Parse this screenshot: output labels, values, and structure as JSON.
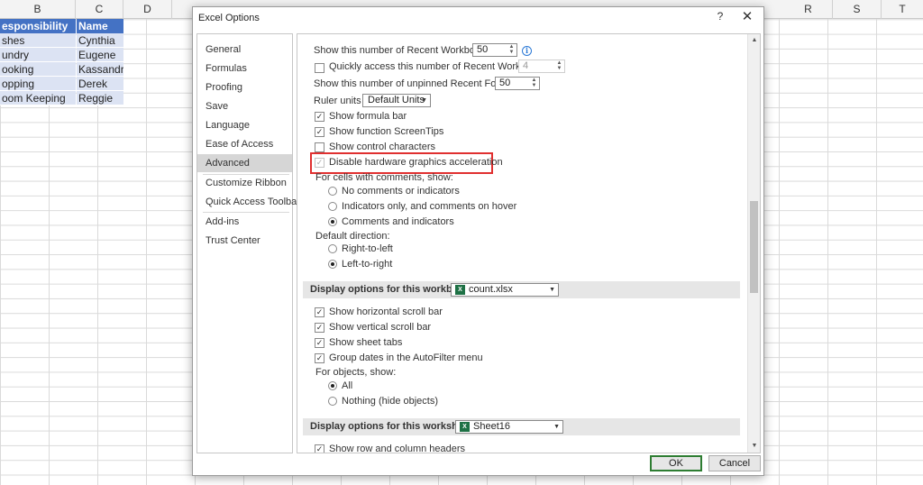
{
  "sheet": {
    "columns": [
      "B",
      "C",
      "D",
      "R",
      "S",
      "T"
    ],
    "header_row": [
      "esponsibility",
      "Name"
    ],
    "rows": [
      [
        "shes",
        "Cynthia"
      ],
      [
        "undry",
        "Eugene"
      ],
      [
        "ooking",
        "Kassandra"
      ],
      [
        "opping",
        "Derek"
      ],
      [
        "oom Keeping",
        "Reggie"
      ]
    ]
  },
  "dialog": {
    "title": "Excel Options",
    "help": "?",
    "close": "✕",
    "nav": [
      "General",
      "Formulas",
      "Proofing",
      "Save",
      "Language",
      "Ease of Access",
      "Advanced",
      "Customize Ribbon",
      "Quick Access Toolbar",
      "Add-ins",
      "Trust Center"
    ],
    "selected_nav": "Advanced",
    "content": {
      "recent_workbooks_label": "Show this number of Recent Workbooks:",
      "recent_workbooks_value": "50",
      "quick_access_label": "Quickly access this number of Recent Workbooks:",
      "quick_access_value": "4",
      "unpinned_folders_label": "Show this number of unpinned Recent Folders:",
      "unpinned_folders_value": "50",
      "ruler_units_label": "Ruler units",
      "ruler_units_value": "Default Units",
      "show_formula_bar": "Show formula bar",
      "show_function_screentips": "Show function ScreenTips",
      "show_control_characters": "Show control characters",
      "disable_hw_accel": "Disable hardware graphics acceleration",
      "comments_label": "For cells with comments, show:",
      "comments_options": [
        "No comments or indicators",
        "Indicators only, and comments on hover",
        "Comments and indicators"
      ],
      "direction_label": "Default direction:",
      "direction_options": [
        "Right-to-left",
        "Left-to-right"
      ],
      "workbook_section": "Display options for this workbook:",
      "workbook_value": "count.xlsx",
      "show_horizontal_scroll": "Show horizontal scroll bar",
      "show_vertical_scroll": "Show vertical scroll bar",
      "show_sheet_tabs": "Show sheet tabs",
      "group_dates": "Group dates in the AutoFilter menu",
      "objects_label": "For objects, show:",
      "objects_options": [
        "All",
        "Nothing (hide objects)"
      ],
      "worksheet_section": "Display options for this worksheet:",
      "worksheet_value": "Sheet16",
      "show_row_col_headers": "Show row and column headers"
    },
    "ok": "OK",
    "cancel": "Cancel",
    "check": "✓",
    "info": "i",
    "excel_badge": "X"
  }
}
